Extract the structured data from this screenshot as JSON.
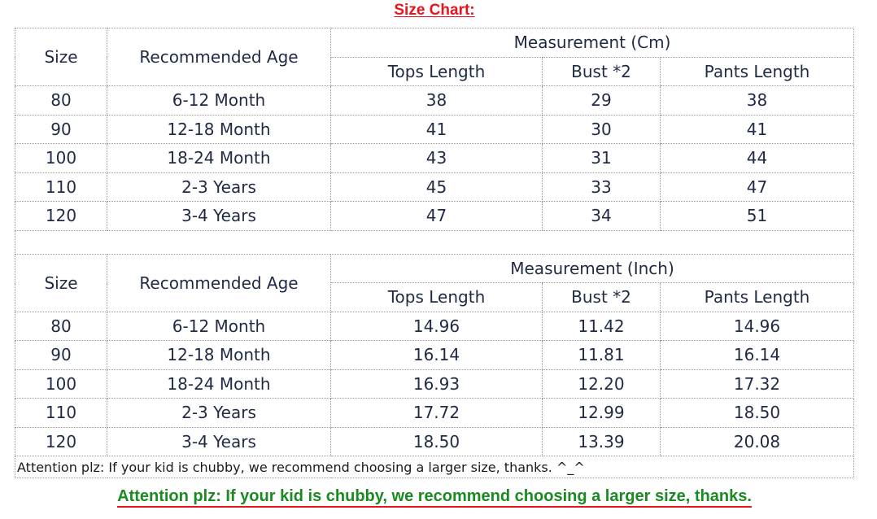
{
  "title": "Size Chart:",
  "headers": {
    "size": "Size",
    "age": "Recommended Age",
    "tops": "Tops Length",
    "bust": "Bust *2",
    "pants": "Pants Length"
  },
  "cm_table": {
    "group_label": "Measurement (Cm)",
    "rows": [
      {
        "size": "80",
        "age": "6-12 Month",
        "tops": "38",
        "bust": "29",
        "pants": "38"
      },
      {
        "size": "90",
        "age": "12-18 Month",
        "tops": "41",
        "bust": "30",
        "pants": "41"
      },
      {
        "size": "100",
        "age": "18-24 Month",
        "tops": "43",
        "bust": "31",
        "pants": "44"
      },
      {
        "size": "110",
        "age": "2-3 Years",
        "tops": "45",
        "bust": "33",
        "pants": "47"
      },
      {
        "size": "120",
        "age": "3-4 Years",
        "tops": "47",
        "bust": "34",
        "pants": "51"
      }
    ]
  },
  "inch_table": {
    "group_label": "Measurement (Inch)",
    "rows": [
      {
        "size": "80",
        "age": "6-12 Month",
        "tops": "14.96",
        "bust": "11.42",
        "pants": "14.96"
      },
      {
        "size": "90",
        "age": "12-18 Month",
        "tops": "16.14",
        "bust": "11.81",
        "pants": "16.14"
      },
      {
        "size": "100",
        "age": "18-24 Month",
        "tops": "16.93",
        "bust": "12.20",
        "pants": "17.32"
      },
      {
        "size": "110",
        "age": "2-3 Years",
        "tops": "17.72",
        "bust": "12.99",
        "pants": "18.50"
      },
      {
        "size": "120",
        "age": "3-4 Years",
        "tops": "18.50",
        "bust": "13.39",
        "pants": "20.08"
      }
    ]
  },
  "note": "Attention plz: If your kid is chubby, we recommend choosing a larger size, thanks. ^_^",
  "footer": "Attention plz: If your kid is chubby, we recommend choosing a larger size, thanks.",
  "colors": {
    "title": "#e8141b",
    "footer_text": "#1b8a22",
    "footer_underline": "#e8141b",
    "text": "#1f2a44"
  }
}
